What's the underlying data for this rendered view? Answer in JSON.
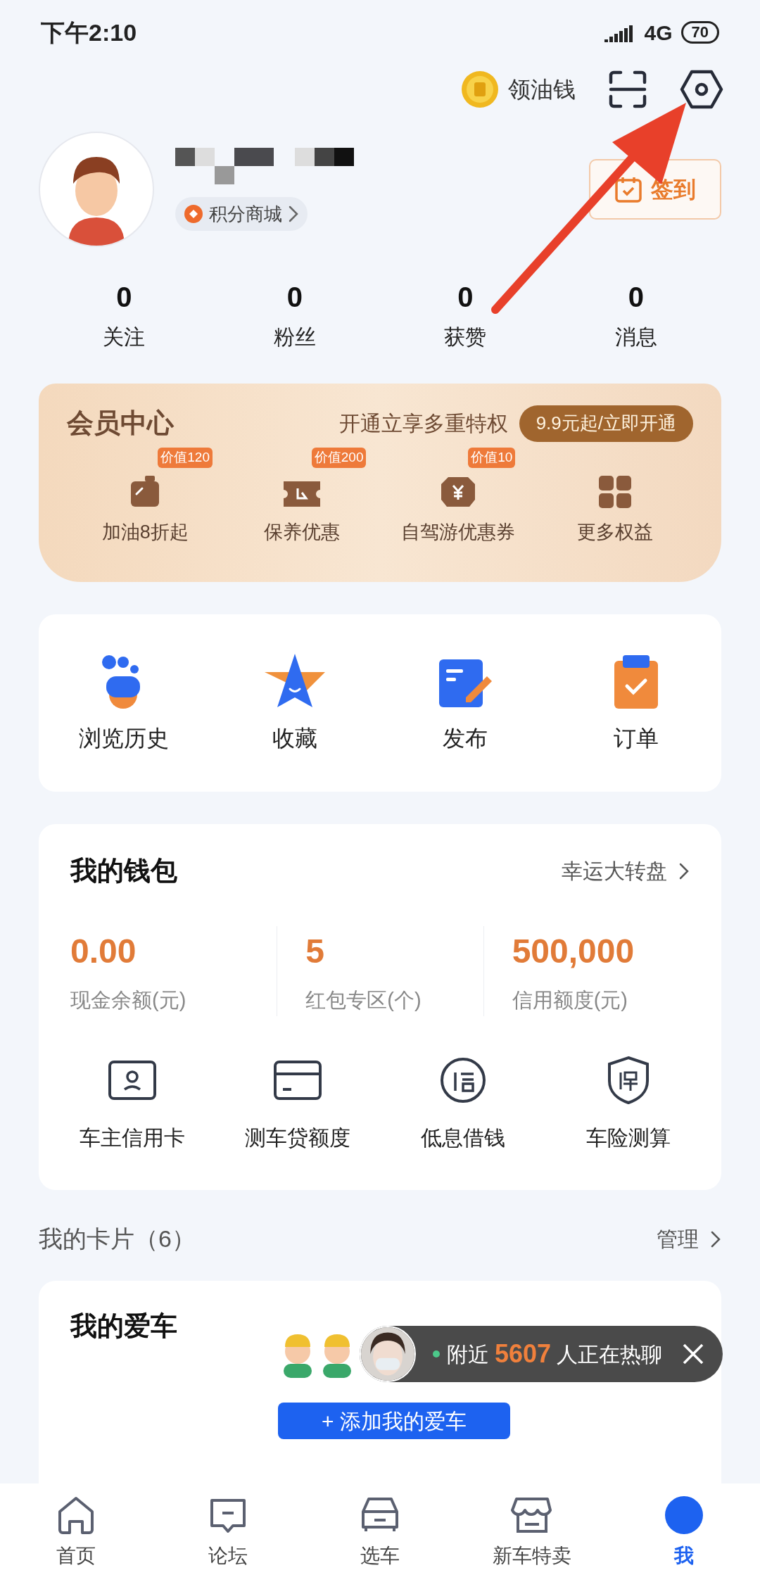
{
  "status_bar": {
    "time": "下午2:10",
    "network": "4G",
    "battery": "70"
  },
  "top_actions": {
    "coin_label": "领油钱"
  },
  "profile": {
    "mall": "积分商城",
    "sign_in": "签到"
  },
  "stats": [
    {
      "value": "0",
      "label": "关注"
    },
    {
      "value": "0",
      "label": "粉丝"
    },
    {
      "value": "0",
      "label": "获赞"
    },
    {
      "value": "0",
      "label": "消息"
    }
  ],
  "vip": {
    "title": "会员中心",
    "slogan": "开通立享多重特权",
    "cta": "9.9元起/立即开通",
    "perks": [
      {
        "kind": "fuel",
        "label": "加油8折起",
        "badge": "价值120"
      },
      {
        "kind": "ticket",
        "label": "保养优惠",
        "badge": "价值200"
      },
      {
        "kind": "travel",
        "label": "自驾游优惠券",
        "badge": "价值10"
      },
      {
        "kind": "more",
        "label": "更多权益"
      }
    ]
  },
  "shortcuts": [
    {
      "kind": "history",
      "label": "浏览历史"
    },
    {
      "kind": "favorite",
      "label": "收藏"
    },
    {
      "kind": "post",
      "label": "发布"
    },
    {
      "kind": "order",
      "label": "订单"
    }
  ],
  "wallet": {
    "title": "我的钱包",
    "link": "幸运大转盘",
    "figures": [
      {
        "value": "0.00",
        "label": "现金余额(元)"
      },
      {
        "value": "5",
        "label": "红包专区(个)"
      },
      {
        "value": "500,000",
        "label": "信用额度(元)"
      }
    ],
    "services": [
      {
        "kind": "card",
        "label": "车主信用卡"
      },
      {
        "kind": "loan",
        "label": "测车贷额度"
      },
      {
        "kind": "borrow",
        "label": "低息借钱"
      },
      {
        "kind": "insurance",
        "label": "车险测算"
      }
    ]
  },
  "cards": {
    "title": "我的卡片（6）",
    "manage": "管理"
  },
  "my_car": {
    "title": "我的爱车",
    "add_button": "+ 添加我的爱车"
  },
  "chat_ticker": {
    "prefix": "附近",
    "count": "5607",
    "suffix": "人正在热聊"
  },
  "bottom_nav": [
    {
      "kind": "home",
      "label": "首页",
      "selected": false
    },
    {
      "kind": "forum",
      "label": "论坛",
      "selected": false
    },
    {
      "kind": "car",
      "label": "选车",
      "selected": false
    },
    {
      "kind": "shop",
      "label": "新车特卖",
      "selected": false
    },
    {
      "kind": "me",
      "label": "我",
      "selected": true
    }
  ]
}
